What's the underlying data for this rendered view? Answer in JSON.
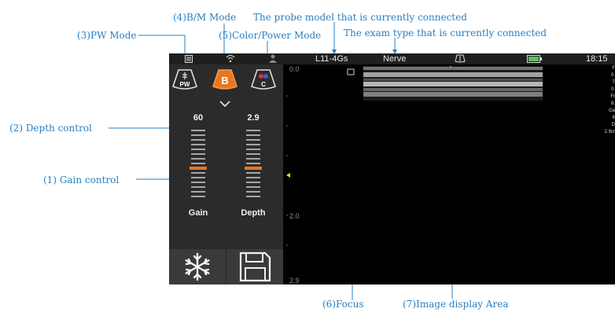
{
  "annotations": {
    "pw_mode": "(3)PW Mode",
    "bm_mode": "(4)B/M Mode",
    "probe_model": "The probe model that is currently connected",
    "color_power": "(5)Color/Power Mode",
    "exam_type": "The exam type that is currently connected",
    "depth_control": "(2) Depth control",
    "gain_control": "(1) Gain control",
    "focus": "(6)Focus",
    "image_area": "(7)Image display Area"
  },
  "statusbar": {
    "probe": "L11-4Gs",
    "exam": "Nerve",
    "time": "18:15"
  },
  "modes": {
    "pw": "PW",
    "b": "B",
    "c": "C"
  },
  "controls": {
    "gain_value": "60",
    "depth_value": "2.9",
    "gain_label": "Gain",
    "depth_label": "Depth"
  },
  "depth_scale": {
    "top": "0.0",
    "mid": "2.0",
    "bottom": "2.9"
  },
  "params": [
    "F",
    "0.",
    "T",
    "0.",
    "Fr",
    "8.",
    "Ga",
    "6",
    "D",
    "2.9cr"
  ],
  "colors": {
    "annotation": "#2a7fc0",
    "accent_orange": "#e87722",
    "focus_yellow": "#f5e600"
  }
}
